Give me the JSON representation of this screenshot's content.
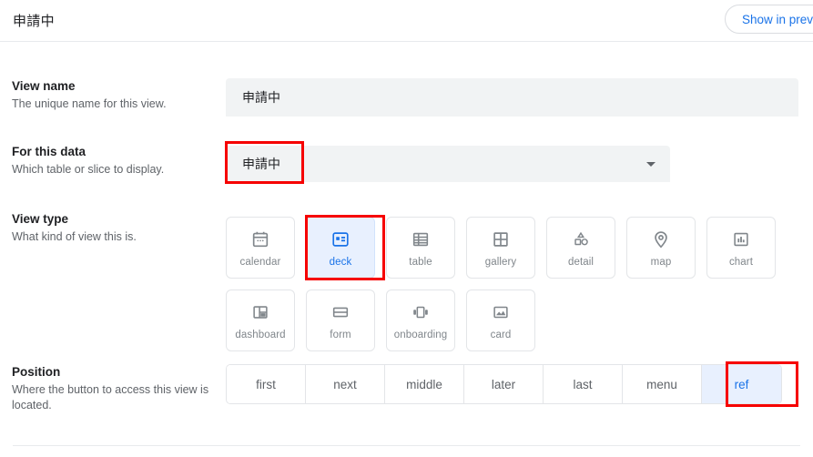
{
  "header": {
    "title": "申請中",
    "preview_button": "Show in preview"
  },
  "fields": {
    "view_name": {
      "title": "View name",
      "desc": "The unique name for this view.",
      "value": "申請中"
    },
    "for_this_data": {
      "title": "For this data",
      "desc": "Which table or slice to display.",
      "value": "申請中",
      "caret_icon": "chevron-down-icon"
    },
    "view_type": {
      "title": "View type",
      "desc": "What kind of view this is.",
      "selected": "deck",
      "options": [
        {
          "label": "calendar",
          "icon": "calendar-icon"
        },
        {
          "label": "deck",
          "icon": "deck-icon"
        },
        {
          "label": "table",
          "icon": "table-icon"
        },
        {
          "label": "gallery",
          "icon": "gallery-icon"
        },
        {
          "label": "detail",
          "icon": "detail-icon"
        },
        {
          "label": "map",
          "icon": "map-pin-icon"
        },
        {
          "label": "chart",
          "icon": "chart-icon"
        },
        {
          "label": "dashboard",
          "icon": "dashboard-icon"
        },
        {
          "label": "form",
          "icon": "form-icon"
        },
        {
          "label": "onboarding",
          "icon": "onboarding-icon"
        },
        {
          "label": "card",
          "icon": "card-icon"
        }
      ]
    },
    "position": {
      "title": "Position",
      "desc": "Where the button to access this view is located.",
      "selected": "ref",
      "options": [
        "first",
        "next",
        "middle",
        "later",
        "last",
        "menu",
        "ref"
      ]
    }
  },
  "colors": {
    "accent": "#1a73e8",
    "accent_bg": "#e8f0fe",
    "field_bg": "#f1f3f4",
    "annotation": "#f60000",
    "muted_text": "#80868b"
  }
}
